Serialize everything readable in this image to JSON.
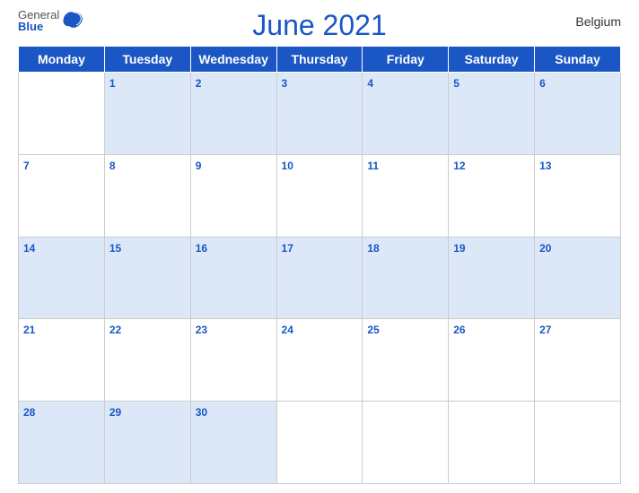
{
  "header": {
    "title": "June 2021",
    "country": "Belgium",
    "logo": {
      "general": "General",
      "blue": "Blue"
    }
  },
  "calendar": {
    "days_of_week": [
      "Monday",
      "Tuesday",
      "Wednesday",
      "Thursday",
      "Friday",
      "Saturday",
      "Sunday"
    ],
    "weeks": [
      [
        null,
        1,
        2,
        3,
        4,
        5,
        6
      ],
      [
        7,
        8,
        9,
        10,
        11,
        12,
        13
      ],
      [
        14,
        15,
        16,
        17,
        18,
        19,
        20
      ],
      [
        21,
        22,
        23,
        24,
        25,
        26,
        27
      ],
      [
        28,
        29,
        30,
        null,
        null,
        null,
        null
      ]
    ]
  },
  "colors": {
    "header_blue": "#1a56c4",
    "row_blue": "#dce8f8",
    "row_white": "#ffffff"
  }
}
